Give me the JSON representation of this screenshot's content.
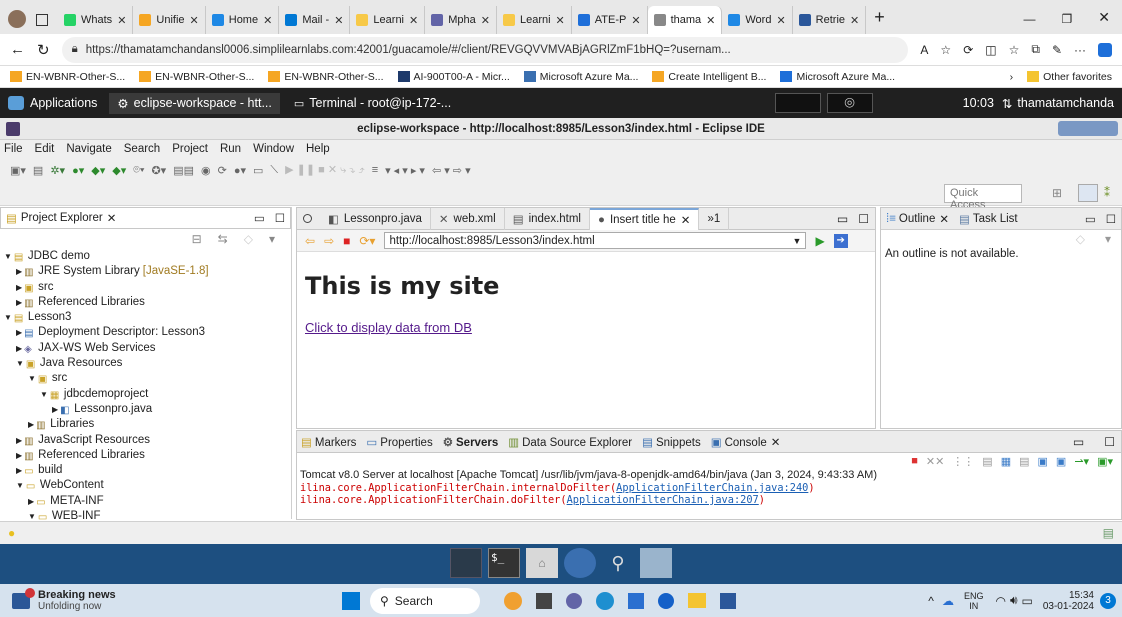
{
  "browser": {
    "tabs": [
      {
        "label": "Whats",
        "color": "#25d366"
      },
      {
        "label": "Unifie",
        "color": "#f5a623"
      },
      {
        "label": "Home",
        "color": "#1e88e5"
      },
      {
        "label": "Mail -",
        "color": "#0078d4"
      },
      {
        "label": "Learni",
        "color": "#f7c948"
      },
      {
        "label": "Mpha",
        "color": "#6264a7"
      },
      {
        "label": "Learni",
        "color": "#f7c948"
      },
      {
        "label": "ATE-P",
        "color": "#1e6fd9"
      },
      {
        "label": "thama",
        "color": "#888888"
      },
      {
        "label": "Word",
        "color": "#1e88e5"
      },
      {
        "label": "Retrie",
        "color": "#2b579a"
      }
    ],
    "url": "https://thamatamchandansl0006.simplilearnlabs.com:42001/guacamole/#/client/REVGQVVMVABjAGRlZmF1bHQ=?usernam...",
    "favorites": [
      "EN-WBNR-Other-S...",
      "EN-WBNR-Other-S...",
      "EN-WBNR-Other-S...",
      "AI-900T00-A - Micr...",
      "Microsoft Azure Ma...",
      "Create Intelligent B...",
      "Microsoft Azure Ma..."
    ],
    "other_favorites": "Other favorites"
  },
  "gnome": {
    "applications": "Applications",
    "eclipse_task": "eclipse-workspace - htt...",
    "terminal_task": "Terminal - root@ip-172-...",
    "time": "10:03",
    "user": "thamatamchanda"
  },
  "eclipse": {
    "title": "eclipse-workspace - http://localhost:8985/Lesson3/index.html - Eclipse IDE",
    "menu": [
      "File",
      "Edit",
      "Navigate",
      "Search",
      "Project",
      "Run",
      "Window",
      "Help"
    ],
    "quick_access": "Quick Access",
    "project_explorer": {
      "title": "Project Explorer",
      "items": [
        {
          "label": "JDBC demo",
          "extra": ""
        },
        {
          "label": "JRE System Library",
          "extra": "[JavaSE-1.8]"
        },
        {
          "label": "src",
          "extra": ""
        },
        {
          "label": "Referenced Libraries",
          "extra": ""
        },
        {
          "label": "Lesson3",
          "extra": ""
        },
        {
          "label": "Deployment Descriptor: Lesson3",
          "extra": ""
        },
        {
          "label": "JAX-WS Web Services",
          "extra": ""
        },
        {
          "label": "Java Resources",
          "extra": ""
        },
        {
          "label": "src",
          "extra": ""
        },
        {
          "label": "jdbcdemoproject",
          "extra": ""
        },
        {
          "label": "Lessonpro.java",
          "extra": ""
        },
        {
          "label": "Libraries",
          "extra": ""
        },
        {
          "label": "JavaScript Resources",
          "extra": ""
        },
        {
          "label": "Referenced Libraries",
          "extra": ""
        },
        {
          "label": "build",
          "extra": ""
        },
        {
          "label": "WebContent",
          "extra": ""
        },
        {
          "label": "META-INF",
          "extra": ""
        },
        {
          "label": "WEB-INF",
          "extra": ""
        }
      ]
    },
    "editor_tabs": [
      "Lessonpro.java",
      "web.xml",
      "index.html",
      "Insert title he",
      "»1"
    ],
    "browser_url": "http://localhost:8985/Lesson3/index.html",
    "page_heading": "This is my site",
    "page_link": "Click to display data from DB",
    "outline": {
      "tab1": "Outline",
      "tab2": "Task List",
      "empty": "An outline is not available."
    },
    "bottom_tabs": [
      "Markers",
      "Properties",
      "Servers",
      "Data Source Explorer",
      "Snippets",
      "Console"
    ],
    "console_header": "Tomcat v8.0 Server at localhost [Apache Tomcat] /usr/lib/jvm/java-8-openjdk-amd64/bin/java (Jan 3, 2024, 9:43:33 AM)",
    "console_lines": [
      {
        "pre": "ilina.core.ApplicationFilterChain.internalDoFilter(",
        "link": "ApplicationFilterChain.java:240",
        "post": ")"
      },
      {
        "pre": "ilina.core.ApplicationFilterChain.doFilter(",
        "link": "ApplicationFilterChain.java:207",
        "post": ")"
      }
    ]
  },
  "taskbar": {
    "news_title": "Breaking news",
    "news_sub": "Unfolding now",
    "search": "Search",
    "lang": "ENG",
    "lang_sub": "IN",
    "time": "15:34",
    "date": "03-01-2024",
    "notif_count": "3"
  }
}
